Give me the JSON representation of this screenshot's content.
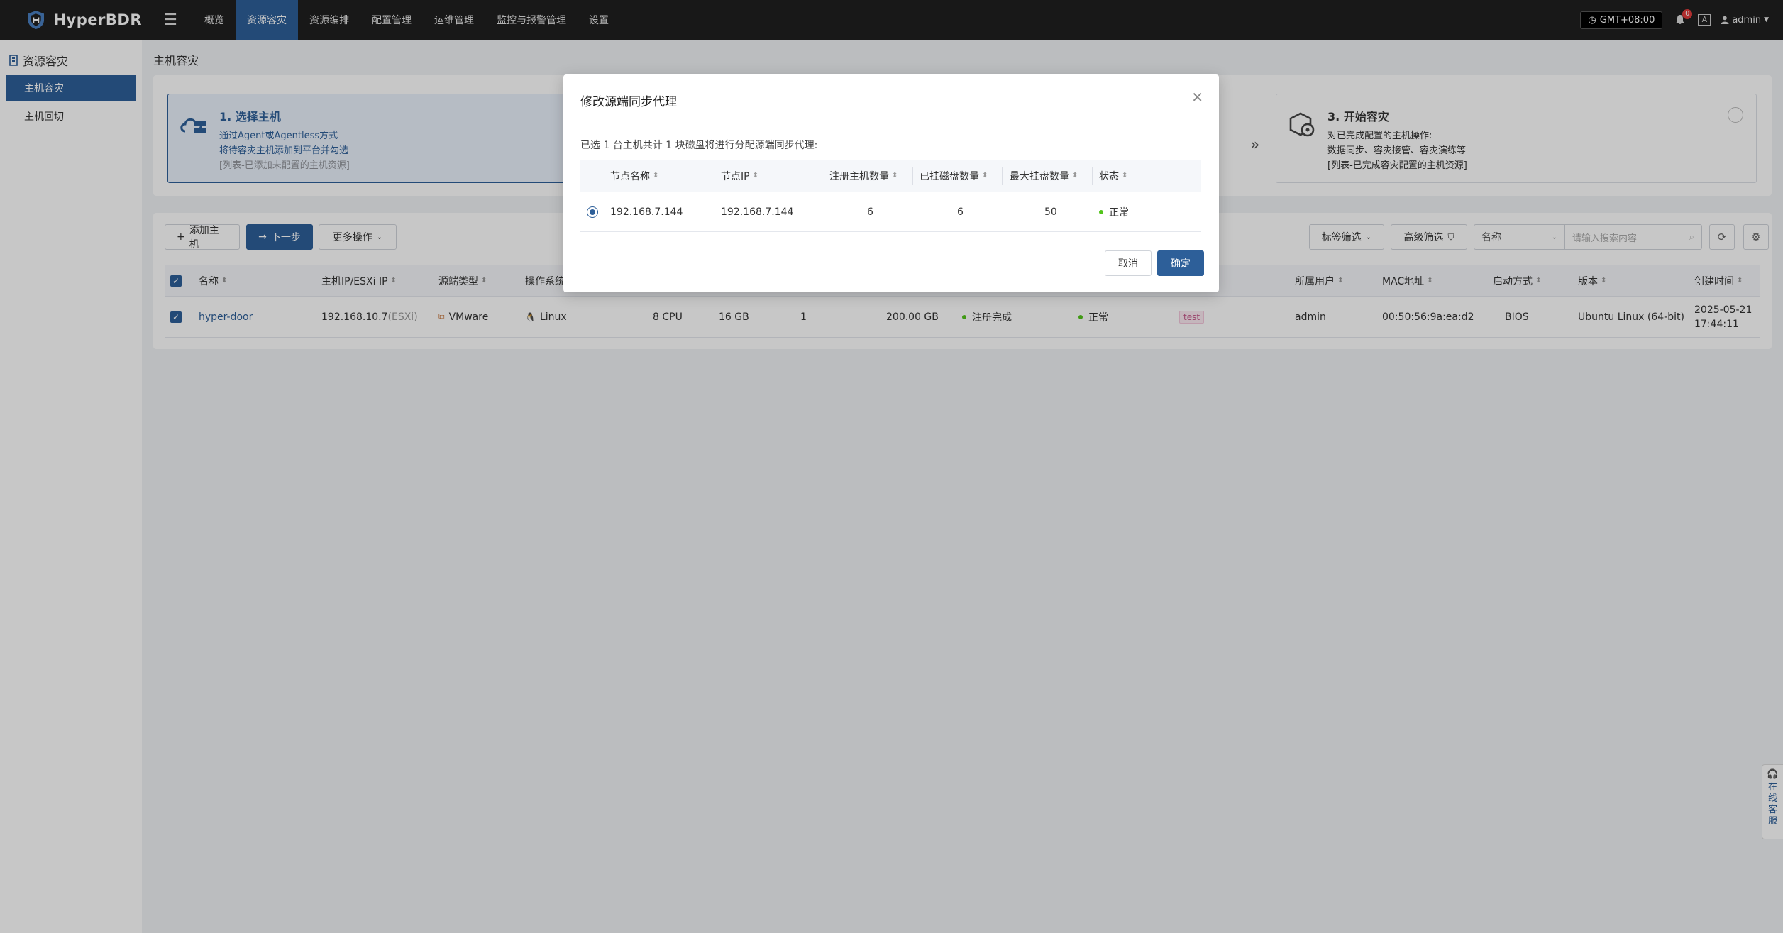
{
  "brand": {
    "name": "HyperBDR"
  },
  "nav": [
    {
      "label": "概览",
      "active": false
    },
    {
      "label": "资源容灾",
      "active": true
    },
    {
      "label": "资源编排",
      "active": false
    },
    {
      "label": "配置管理",
      "active": false
    },
    {
      "label": "运维管理",
      "active": false
    },
    {
      "label": "监控与报警管理",
      "active": false
    },
    {
      "label": "设置",
      "active": false
    }
  ],
  "topright": {
    "timezone": "GMT+08:00",
    "notification_count": "0",
    "lang_icon": "A",
    "user": "admin"
  },
  "sidebar": {
    "title": "资源容灾",
    "items": [
      {
        "label": "主机容灾",
        "active": true
      },
      {
        "label": "主机回切",
        "active": false
      }
    ]
  },
  "page": {
    "title": "主机容灾"
  },
  "steps": [
    {
      "title": "1. 选择主机",
      "lines": [
        "通过Agent或Agentless方式",
        "将待容灾主机添加到平台并勾选"
      ],
      "note": "[列表-已添加未配置的主机资源]",
      "active": true
    },
    {
      "title": "3. 开始容灾",
      "lines": [
        "对已完成配置的主机操作:",
        "数据同步、容灾接管、容灾演练等"
      ],
      "note": "[列表-已完成容灾配置的主机资源]",
      "active": false
    }
  ],
  "toolbar": {
    "add_host": "添加主机",
    "next_step": "下一步",
    "more_actions": "更多操作",
    "tag_filter": "标签筛选",
    "advanced_filter": "高级筛选",
    "search_field": "名称",
    "search_placeholder": "请输入搜索内容"
  },
  "table": {
    "headers": {
      "name": "名称",
      "ip": "主机IP/ESXi IP",
      "source_type": "源端类型",
      "os": "操作系统",
      "owner": "所属用户",
      "mac": "MAC地址",
      "boot": "启动方式",
      "version": "版本",
      "created": "创建时间"
    },
    "rows": [
      {
        "name": "hyper-door",
        "ip": "192.168.10.7",
        "ip_suffix": "(ESXi)",
        "source_type": "VMware",
        "os": "Linux",
        "cpu": "8 CPU",
        "memory": "16 GB",
        "disks": "1",
        "disk_size": "200.00 GB",
        "register_status": "注册完成",
        "status": "正常",
        "tag": "test",
        "owner": "admin",
        "mac": "00:50:56:9a:ea:d2",
        "boot": "BIOS",
        "version": "Ubuntu Linux (64-bit)",
        "created_date": "2025-05-21",
        "created_time": "17:44:11"
      }
    ]
  },
  "modal": {
    "title": "修改源端同步代理",
    "description": "已选 1 台主机共计 1 块磁盘将进行分配源端同步代理:",
    "headers": {
      "node_name": "节点名称",
      "node_ip": "节点IP",
      "registered_hosts": "注册主机数量",
      "mounted_disks": "已挂磁盘数量",
      "max_disks": "最大挂盘数量",
      "status": "状态"
    },
    "rows": [
      {
        "node_name": "192.168.7.144",
        "node_ip": "192.168.7.144",
        "registered_hosts": "6",
        "mounted_disks": "6",
        "max_disks": "50",
        "status": "正常",
        "selected": true
      }
    ],
    "cancel": "取消",
    "confirm": "确定"
  },
  "help": {
    "chars": [
      "在",
      "线",
      "客",
      "服"
    ]
  },
  "colors": {
    "primary": "#2d5f99",
    "topbar": "#1f1f1f",
    "success": "#52c41a"
  }
}
